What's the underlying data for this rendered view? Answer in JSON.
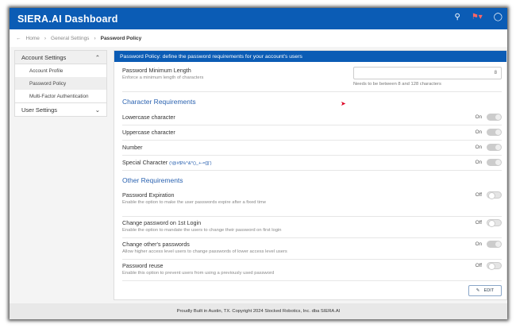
{
  "header": {
    "title": "SIERA.AI Dashboard",
    "icons": [
      "lightbulb-icon",
      "flag-icon",
      "help-icon"
    ]
  },
  "breadcrumb": {
    "items": [
      "Home",
      "General Settings",
      "Password Policy"
    ]
  },
  "sidebar": {
    "sections": [
      {
        "label": "Account Settings",
        "expanded": true,
        "items": [
          "Account Profile",
          "Password Policy",
          "Multi-Factor Authentication"
        ],
        "active": "Password Policy"
      },
      {
        "label": "User Settings",
        "expanded": false
      }
    ]
  },
  "main": {
    "banner": "Password Policy: define the password requirements for your account's users",
    "min_length": {
      "label": "Password Minimum Length",
      "desc": "Enforce a minimum length of characters",
      "value": "8",
      "hint": "Needs to be between 8 and 128 characters"
    },
    "char_heading": "Character Requirements",
    "char_items": [
      {
        "label": "Lowercase character",
        "state": "On"
      },
      {
        "label": "Uppercase character",
        "state": "On"
      },
      {
        "label": "Number",
        "state": "On"
      },
      {
        "label": "Special Character",
        "extra": "(!@#$%^&*()_+-=[]|')",
        "state": "On"
      }
    ],
    "other_heading": "Other Requirements",
    "other_items": [
      {
        "label": "Password Expiration",
        "desc": "Enable the option to make the user passwords expire after a fixed time",
        "state": "Off"
      },
      {
        "label": "Change password on 1st Login",
        "desc": "Enable the option to mandate the users to change their password on first login",
        "state": "Off"
      },
      {
        "label": "Change other's passwords",
        "desc": "Allow higher access level users to change passwords of lower access level users",
        "state": "On"
      },
      {
        "label": "Password reuse",
        "desc": "Enable this option to prevent users from using a previously used password",
        "state": "Off"
      }
    ],
    "edit_label": "EDIT"
  },
  "footer": "Proudly Built in Austin, TX. Copyright 2024 Stocked Robotics, Inc. dba SIERA.AI",
  "colors": {
    "brand": "#0b5cb5",
    "heading": "#2a62b0"
  }
}
